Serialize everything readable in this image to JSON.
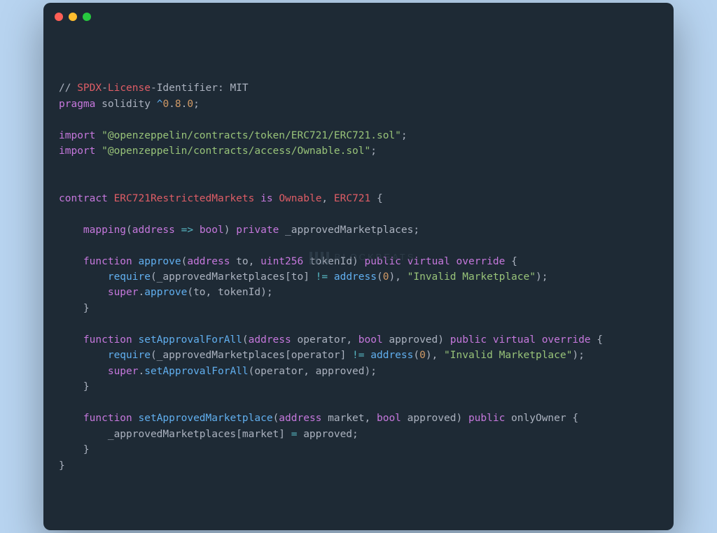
{
  "watermark": "BLOCKBEATS",
  "tokens": [
    [
      [
        "t-default",
        "// "
      ],
      [
        "t-red",
        "SPDX"
      ],
      [
        "t-default",
        "-"
      ],
      [
        "t-red",
        "License"
      ],
      [
        "t-default",
        "-Identifier: MIT"
      ]
    ],
    [
      [
        "t-purple",
        "pragma"
      ],
      [
        "t-default",
        " solidity "
      ],
      [
        "t-blue",
        "^"
      ],
      [
        "t-orange",
        "0"
      ],
      [
        "t-default",
        "."
      ],
      [
        "t-orange",
        "8"
      ],
      [
        "t-default",
        "."
      ],
      [
        "t-orange",
        "0"
      ],
      [
        "t-default",
        ";"
      ]
    ],
    [],
    [
      [
        "t-purple",
        "import"
      ],
      [
        "t-default",
        " "
      ],
      [
        "t-green",
        "\"@openzeppelin/contracts/token/ERC721/ERC721.sol\""
      ],
      [
        "t-default",
        ";"
      ]
    ],
    [
      [
        "t-purple",
        "import"
      ],
      [
        "t-default",
        " "
      ],
      [
        "t-green",
        "\"@openzeppelin/contracts/access/Ownable.sol\""
      ],
      [
        "t-default",
        ";"
      ]
    ],
    [],
    [],
    [
      [
        "t-purple",
        "contract"
      ],
      [
        "t-default",
        " "
      ],
      [
        "t-red",
        "ERC721RestrictedMarkets"
      ],
      [
        "t-default",
        " "
      ],
      [
        "t-purple",
        "is"
      ],
      [
        "t-default",
        " "
      ],
      [
        "t-red",
        "Ownable"
      ],
      [
        "t-default",
        ", "
      ],
      [
        "t-red",
        "ERC721"
      ],
      [
        "t-default",
        " {"
      ]
    ],
    [],
    [
      [
        "t-default",
        "    "
      ],
      [
        "t-purple",
        "mapping"
      ],
      [
        "t-default",
        "("
      ],
      [
        "t-purple",
        "address"
      ],
      [
        "t-default",
        " "
      ],
      [
        "t-cyan",
        "=>"
      ],
      [
        "t-default",
        " "
      ],
      [
        "t-purple",
        "bool"
      ],
      [
        "t-default",
        ") "
      ],
      [
        "t-purple",
        "private"
      ],
      [
        "t-default",
        " _approvedMarketplaces;"
      ]
    ],
    [],
    [
      [
        "t-default",
        "    "
      ],
      [
        "t-purple",
        "function"
      ],
      [
        "t-default",
        " "
      ],
      [
        "t-blue",
        "approve"
      ],
      [
        "t-default",
        "("
      ],
      [
        "t-purple",
        "address"
      ],
      [
        "t-default",
        " to, "
      ],
      [
        "t-purple",
        "uint256"
      ],
      [
        "t-default",
        " tokenId) "
      ],
      [
        "t-purple",
        "public"
      ],
      [
        "t-default",
        " "
      ],
      [
        "t-purple",
        "virtual"
      ],
      [
        "t-default",
        " "
      ],
      [
        "t-purple",
        "override"
      ],
      [
        "t-default",
        " {"
      ]
    ],
    [
      [
        "t-default",
        "        "
      ],
      [
        "t-blue",
        "require"
      ],
      [
        "t-default",
        "(_approvedMarketplaces[to] "
      ],
      [
        "t-cyan",
        "!="
      ],
      [
        "t-default",
        " "
      ],
      [
        "t-blue",
        "address"
      ],
      [
        "t-default",
        "("
      ],
      [
        "t-orange",
        "0"
      ],
      [
        "t-default",
        "), "
      ],
      [
        "t-green",
        "\"Invalid Marketplace\""
      ],
      [
        "t-default",
        ");"
      ]
    ],
    [
      [
        "t-default",
        "        "
      ],
      [
        "t-purple",
        "super"
      ],
      [
        "t-default",
        "."
      ],
      [
        "t-blue",
        "approve"
      ],
      [
        "t-default",
        "(to, tokenId);"
      ]
    ],
    [
      [
        "t-default",
        "    }"
      ]
    ],
    [],
    [
      [
        "t-default",
        "    "
      ],
      [
        "t-purple",
        "function"
      ],
      [
        "t-default",
        " "
      ],
      [
        "t-blue",
        "setApprovalForAll"
      ],
      [
        "t-default",
        "("
      ],
      [
        "t-purple",
        "address"
      ],
      [
        "t-default",
        " operator, "
      ],
      [
        "t-purple",
        "bool"
      ],
      [
        "t-default",
        " approved) "
      ],
      [
        "t-purple",
        "public"
      ],
      [
        "t-default",
        " "
      ],
      [
        "t-purple",
        "virtual"
      ],
      [
        "t-default",
        " "
      ],
      [
        "t-purple",
        "override"
      ],
      [
        "t-default",
        " {"
      ]
    ],
    [
      [
        "t-default",
        "        "
      ],
      [
        "t-blue",
        "require"
      ],
      [
        "t-default",
        "(_approvedMarketplaces[operator] "
      ],
      [
        "t-cyan",
        "!="
      ],
      [
        "t-default",
        " "
      ],
      [
        "t-blue",
        "address"
      ],
      [
        "t-default",
        "("
      ],
      [
        "t-orange",
        "0"
      ],
      [
        "t-default",
        "), "
      ],
      [
        "t-green",
        "\"Invalid Marketplace\""
      ],
      [
        "t-default",
        ");"
      ]
    ],
    [
      [
        "t-default",
        "        "
      ],
      [
        "t-purple",
        "super"
      ],
      [
        "t-default",
        "."
      ],
      [
        "t-blue",
        "setApprovalForAll"
      ],
      [
        "t-default",
        "(operator, approved);"
      ]
    ],
    [
      [
        "t-default",
        "    }"
      ]
    ],
    [],
    [
      [
        "t-default",
        "    "
      ],
      [
        "t-purple",
        "function"
      ],
      [
        "t-default",
        " "
      ],
      [
        "t-blue",
        "setApprovedMarketplace"
      ],
      [
        "t-default",
        "("
      ],
      [
        "t-purple",
        "address"
      ],
      [
        "t-default",
        " market, "
      ],
      [
        "t-purple",
        "bool"
      ],
      [
        "t-default",
        " approved) "
      ],
      [
        "t-purple",
        "public"
      ],
      [
        "t-default",
        " onlyOwner {"
      ]
    ],
    [
      [
        "t-default",
        "        _approvedMarketplaces[market] "
      ],
      [
        "t-cyan",
        "="
      ],
      [
        "t-default",
        " approved;"
      ]
    ],
    [
      [
        "t-default",
        "    }"
      ]
    ],
    [
      [
        "t-default",
        "}"
      ]
    ]
  ]
}
